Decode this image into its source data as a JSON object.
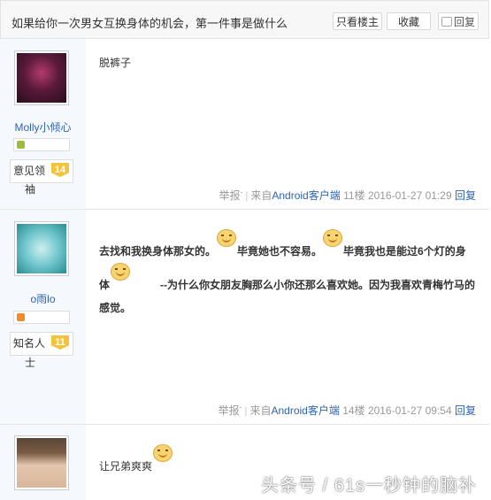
{
  "header": {
    "title": "如果给你一次男女互换身体的机会，第一件事是做什么",
    "only_op": "只看楼主",
    "favorite": "收藏",
    "reply": "回复"
  },
  "posts": [
    {
      "username": "Molly小倾心",
      "level_title_1": "意见领",
      "level_title_2": "袖",
      "level": "14",
      "content": "脱裤子",
      "report": "举报",
      "source_prefix": "来自",
      "source_app": "Android客户端",
      "floor": "11楼",
      "time": "2016-01-27 01:29",
      "reply": "回复"
    },
    {
      "username": "o雨lo",
      "level_title_1": "知名人",
      "level_title_2": "士",
      "level": "11",
      "content_parts": [
        "去找和我换身体那女的。",
        "毕竟她也不容易。",
        "毕竟我也是能过6个灯的身体",
        "--为什么你女朋友胸那么小你还那么喜欢她。因为我喜欢青梅竹马的感觉。"
      ],
      "report": "举报",
      "source_prefix": "来自",
      "source_app": "Android客户端",
      "floor": "14楼",
      "time": "2016-01-27 09:54",
      "reply": "回复"
    },
    {
      "content": "让兄弟爽爽"
    }
  ],
  "watermark": "头条号 / 61s一秒钟的脑补",
  "colors": {
    "link": "#2d64b3",
    "level_badge": "#f4c33c",
    "sidebar_bg": "#f5f8fc"
  }
}
